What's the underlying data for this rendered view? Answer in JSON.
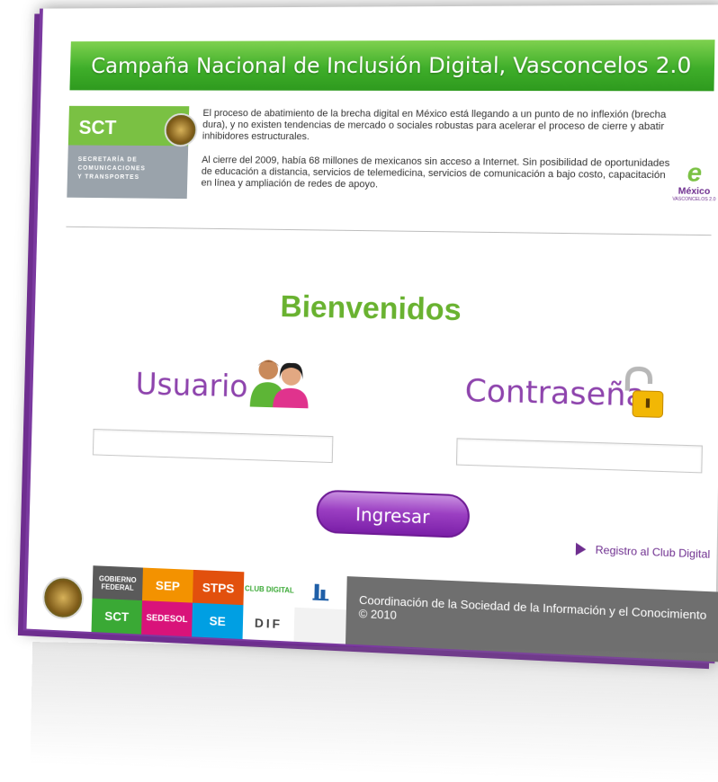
{
  "banner": {
    "title": "Campaña Nacional de Inclusión Digital, Vasconcelos 2.0"
  },
  "sct_logo": {
    "abbr": "SCT",
    "line1": "SECRETARÍA DE",
    "line2": "COMUNICACIONES",
    "line3": "Y TRANSPORTES"
  },
  "intro": {
    "paragraph1": "El proceso de abatimiento de la brecha digital en México está llegando a un punto de no inflexión (brecha dura), y no existen tendencias de mercado o sociales robustas para acelerar el proceso de cierre y abatir inhibidores estructurales.",
    "paragraph2": "Al cierre del 2009, había 68 millones de mexicanos sin acceso a Internet. Sin posibilidad de oportunidades de educación a distancia, servicios de telemedicina, servicios de comunicación a bajo costo, capacitación en línea y ampliación de redes de apoyo."
  },
  "emexico": {
    "letter": "e",
    "name": "México",
    "sub": "VASCONCELOS 2.0"
  },
  "login": {
    "welcome": "Bienvenidos",
    "user_label": "Usuario",
    "password_label": "Contraseña",
    "user_value": "",
    "password_value": "",
    "submit_label": "Ingresar",
    "register_link": "Registro al Club Digital"
  },
  "footer": {
    "logos": [
      {
        "text": "GOBIERNO FEDERAL",
        "bg": "#5a5a5a"
      },
      {
        "text": "SEP",
        "bg": "#f39200"
      },
      {
        "text": "STPS",
        "bg": "#e2500d"
      },
      {
        "text": "CLUB DIGITAL",
        "bg": "#ffffff"
      },
      {
        "text": "",
        "bg": "#ffffff"
      },
      {
        "text": "SCT",
        "bg": "#3aa935"
      },
      {
        "text": "SEDESOL",
        "bg": "#d9137a"
      },
      {
        "text": "SE",
        "bg": "#009fe3"
      },
      {
        "text": "DIF",
        "bg": "#ffffff"
      },
      {
        "text": "",
        "bg": "#f2f2f2"
      }
    ],
    "credit": "Coordinación de la Sociedad de la Información y el  Conocimiento © 2010"
  },
  "colors": {
    "banner_green": "#3fae2a",
    "welcome_green": "#69b230",
    "accent_purple": "#8e44ad",
    "footer_gray": "#6f6f6f"
  }
}
